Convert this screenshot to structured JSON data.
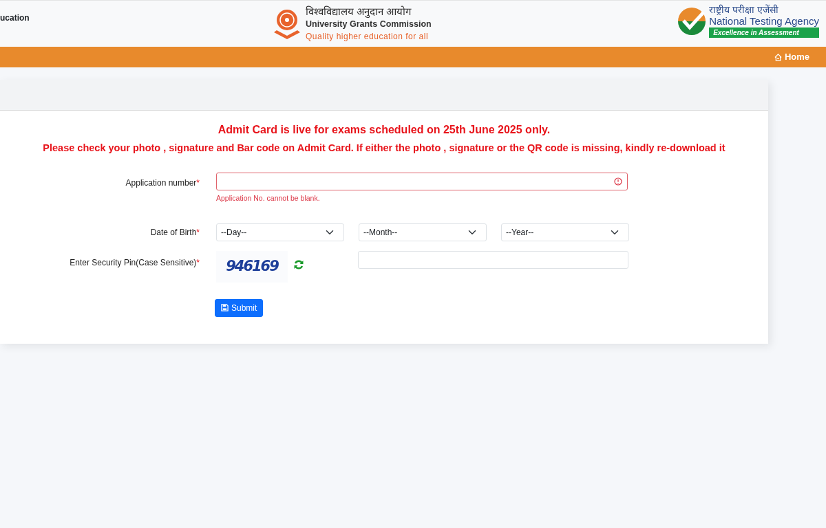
{
  "header": {
    "left_text": "ucation",
    "ugc": {
      "hindi": "विश्वविद्यालय अनुदान आयोग",
      "english": "University Grants Commission",
      "tagline": "Quality higher education for all"
    },
    "nta": {
      "hindi": "राष्ट्रीय परीक्षा एजेंसी",
      "english": "National Testing Agency",
      "tagline": "Excellence in Assessment"
    }
  },
  "nav": {
    "home": "Home"
  },
  "notices": [
    "Admit Card is live for exams scheduled on 25th June 2025 only.",
    "Please check your photo , signature and Bar code on Admit Card. If either the photo , signature or the QR code is missing, kindly re-download it"
  ],
  "form": {
    "rows": [
      {
        "kind": "text",
        "label": "Application number",
        "required_mark": "*",
        "invalid": true,
        "error": "Application No. cannot be blank."
      },
      {
        "kind": "selects",
        "label": "Date of Birth",
        "required_mark": "*",
        "selects": [
          "--Day--",
          "--Month--",
          "--Year--"
        ]
      },
      {
        "kind": "captcha",
        "label": "Enter Security Pin(Case Sensitive)",
        "required_mark": "*",
        "captcha": "946169"
      }
    ],
    "submit": "Submit"
  }
}
